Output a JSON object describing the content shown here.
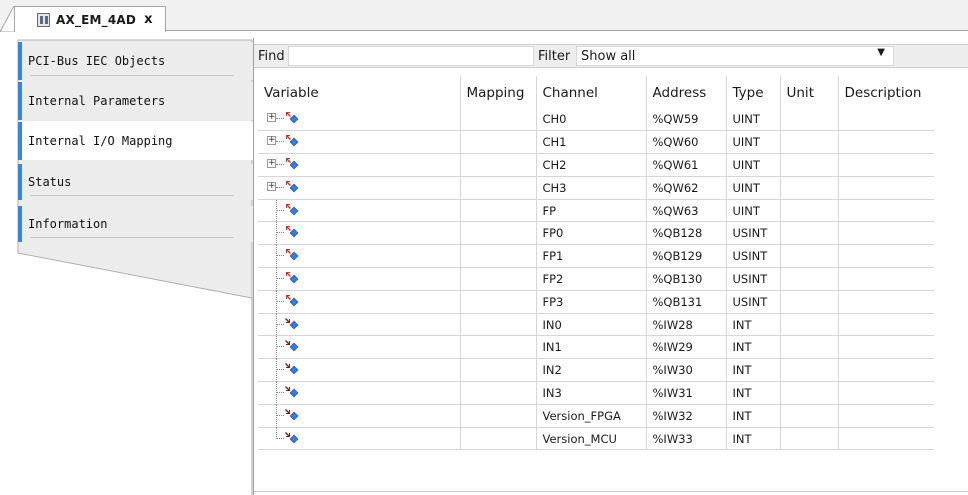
{
  "document_tab": {
    "title": "AX_EM_4AD",
    "close_label": "x"
  },
  "side_tabs": [
    {
      "label": "PCI-Bus IEC Objects",
      "active": false
    },
    {
      "label": "Internal Parameters",
      "active": false
    },
    {
      "label": "Internal I/O Mapping",
      "active": true
    },
    {
      "label": "Status",
      "active": false
    },
    {
      "label": "Information",
      "active": false
    }
  ],
  "toolbar": {
    "find_label": "Find",
    "find_value": "",
    "filter_label": "Filter",
    "filter_value": "Show all"
  },
  "table": {
    "columns": [
      "Variable",
      "Mapping",
      "Channel",
      "Address",
      "Type",
      "Unit",
      "Description"
    ],
    "rows": [
      {
        "expandable": true,
        "direction": "output",
        "variable": "",
        "mapping": "",
        "channel": "CH0",
        "address": "%QW59",
        "type": "UINT",
        "unit": "",
        "description": ""
      },
      {
        "expandable": true,
        "direction": "output",
        "variable": "",
        "mapping": "",
        "channel": "CH1",
        "address": "%QW60",
        "type": "UINT",
        "unit": "",
        "description": ""
      },
      {
        "expandable": true,
        "direction": "output",
        "variable": "",
        "mapping": "",
        "channel": "CH2",
        "address": "%QW61",
        "type": "UINT",
        "unit": "",
        "description": ""
      },
      {
        "expandable": true,
        "direction": "output",
        "variable": "",
        "mapping": "",
        "channel": "CH3",
        "address": "%QW62",
        "type": "UINT",
        "unit": "",
        "description": ""
      },
      {
        "expandable": false,
        "direction": "output",
        "variable": "",
        "mapping": "",
        "channel": "FP",
        "address": "%QW63",
        "type": "UINT",
        "unit": "",
        "description": ""
      },
      {
        "expandable": false,
        "direction": "output",
        "variable": "",
        "mapping": "",
        "channel": "FP0",
        "address": "%QB128",
        "type": "USINT",
        "unit": "",
        "description": ""
      },
      {
        "expandable": false,
        "direction": "output",
        "variable": "",
        "mapping": "",
        "channel": "FP1",
        "address": "%QB129",
        "type": "USINT",
        "unit": "",
        "description": ""
      },
      {
        "expandable": false,
        "direction": "output",
        "variable": "",
        "mapping": "",
        "channel": "FP2",
        "address": "%QB130",
        "type": "USINT",
        "unit": "",
        "description": ""
      },
      {
        "expandable": false,
        "direction": "output",
        "variable": "",
        "mapping": "",
        "channel": "FP3",
        "address": "%QB131",
        "type": "USINT",
        "unit": "",
        "description": ""
      },
      {
        "expandable": false,
        "direction": "input",
        "variable": "",
        "mapping": "",
        "channel": "IN0",
        "address": "%IW28",
        "type": "INT",
        "unit": "",
        "description": ""
      },
      {
        "expandable": false,
        "direction": "input",
        "variable": "",
        "mapping": "",
        "channel": "IN1",
        "address": "%IW29",
        "type": "INT",
        "unit": "",
        "description": ""
      },
      {
        "expandable": false,
        "direction": "input",
        "variable": "",
        "mapping": "",
        "channel": "IN2",
        "address": "%IW30",
        "type": "INT",
        "unit": "",
        "description": ""
      },
      {
        "expandable": false,
        "direction": "input",
        "variable": "",
        "mapping": "",
        "channel": "IN3",
        "address": "%IW31",
        "type": "INT",
        "unit": "",
        "description": ""
      },
      {
        "expandable": false,
        "direction": "input",
        "variable": "",
        "mapping": "",
        "channel": "Version_FPGA",
        "address": "%IW32",
        "type": "INT",
        "unit": "",
        "description": ""
      },
      {
        "expandable": false,
        "direction": "input",
        "variable": "",
        "mapping": "",
        "channel": "Version_MCU",
        "address": "%IW33",
        "type": "INT",
        "unit": "",
        "description": ""
      }
    ]
  },
  "colors": {
    "accent": "#3a86d4",
    "output_arrow": "#c0392b",
    "input_arrow": "#8b1a1a",
    "diamond": "#3a7bd5"
  }
}
